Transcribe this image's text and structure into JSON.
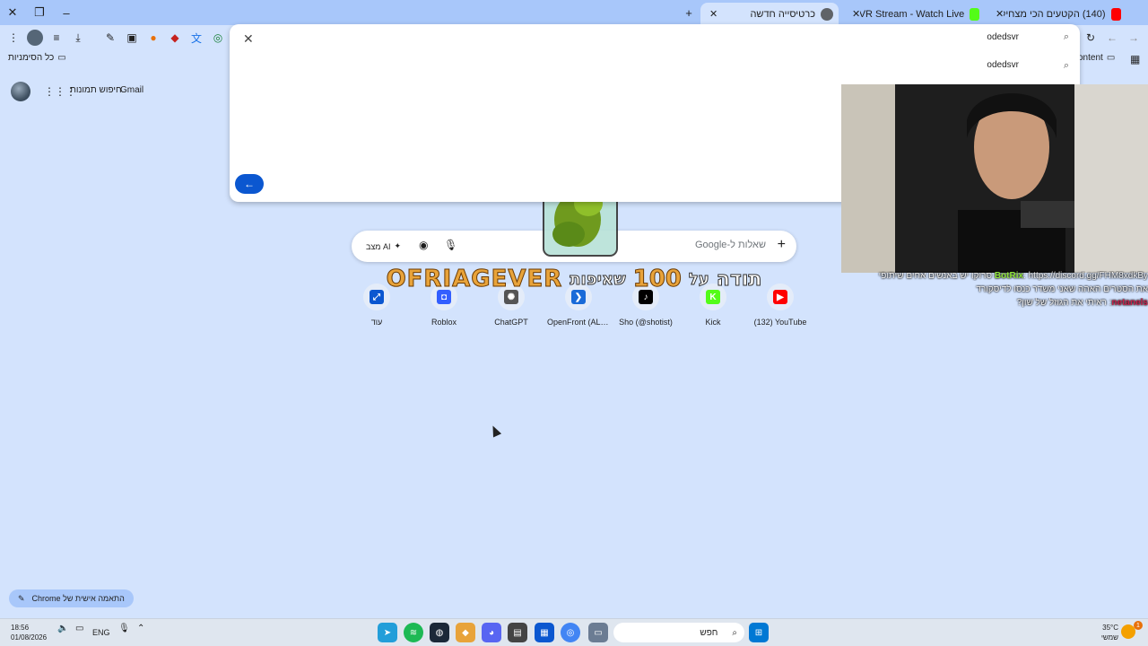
{
  "tabs": [
    {
      "label": "(140) הקטעים הכי מצחיקים ש",
      "favicon_color": "#ff0000"
    },
    {
      "label": "OdedSVR Stream - Watch Live",
      "favicon_color": "#53fc18"
    },
    {
      "label": "כרטיסייה חדשה",
      "favicon_color": "#5f6368"
    }
  ],
  "bookmarks": {
    "all_bookmarks": "כל הסימניות",
    "content": "ontent"
  },
  "omnibox": {
    "typed_text": "odedsvr",
    "suggestion": "odedsvr"
  },
  "google_bar": {
    "gmail": "Gmail",
    "images": "חיפוש תמונות"
  },
  "searchbox": {
    "placeholder": "שאלות ל-Google",
    "ai_mode": "מצב AI"
  },
  "shortcuts": [
    {
      "label": "עוד",
      "icon": "expand-icon",
      "color": "#0b57d0",
      "glyph": "⤢"
    },
    {
      "label": "Roblox",
      "icon": "roblox-icon",
      "color": "#335fff",
      "glyph": "◘"
    },
    {
      "label": "ChatGPT",
      "icon": "chatgpt-icon",
      "color": "#555555",
      "glyph": "✺"
    },
    {
      "label": "OpenFront (ALP...",
      "icon": "openfront-icon",
      "color": "#1a6bd8",
      "glyph": "❯"
    },
    {
      "label": "Sho (@shotist)",
      "icon": "tiktok-icon",
      "color": "#000000",
      "glyph": "♪"
    },
    {
      "label": "Kick",
      "icon": "kick-icon",
      "color": "#53fc18",
      "glyph": "K"
    },
    {
      "label": "(132) YouTube",
      "icon": "youtube-icon",
      "color": "#ff0000",
      "glyph": "▶"
    }
  ],
  "overlay": {
    "name": "OFRIAGEVER",
    "thanks": "תודה",
    "of": "על",
    "amount": "100",
    "word": "שאיפות"
  },
  "chat": [
    {
      "user": "BotRix",
      "text": ": https://discord.gg/FHM8xdkBy סרוקו יש באנשים אחים שיתופי"
    },
    {
      "user": "",
      "text": "את הסטרים האהה שאני משדר כנסו לדיסקורד"
    },
    {
      "user": "netanels",
      "text": ": ראיתי את הגוזל של שון?"
    }
  ],
  "customize_chrome": "התאמה אישית של Chrome",
  "taskbar": {
    "time": "18:56",
    "date": "01/08/2026",
    "lang": "ENG",
    "search": "חפש",
    "temp": "35°C",
    "weather": "שמשי",
    "badge": "1"
  }
}
